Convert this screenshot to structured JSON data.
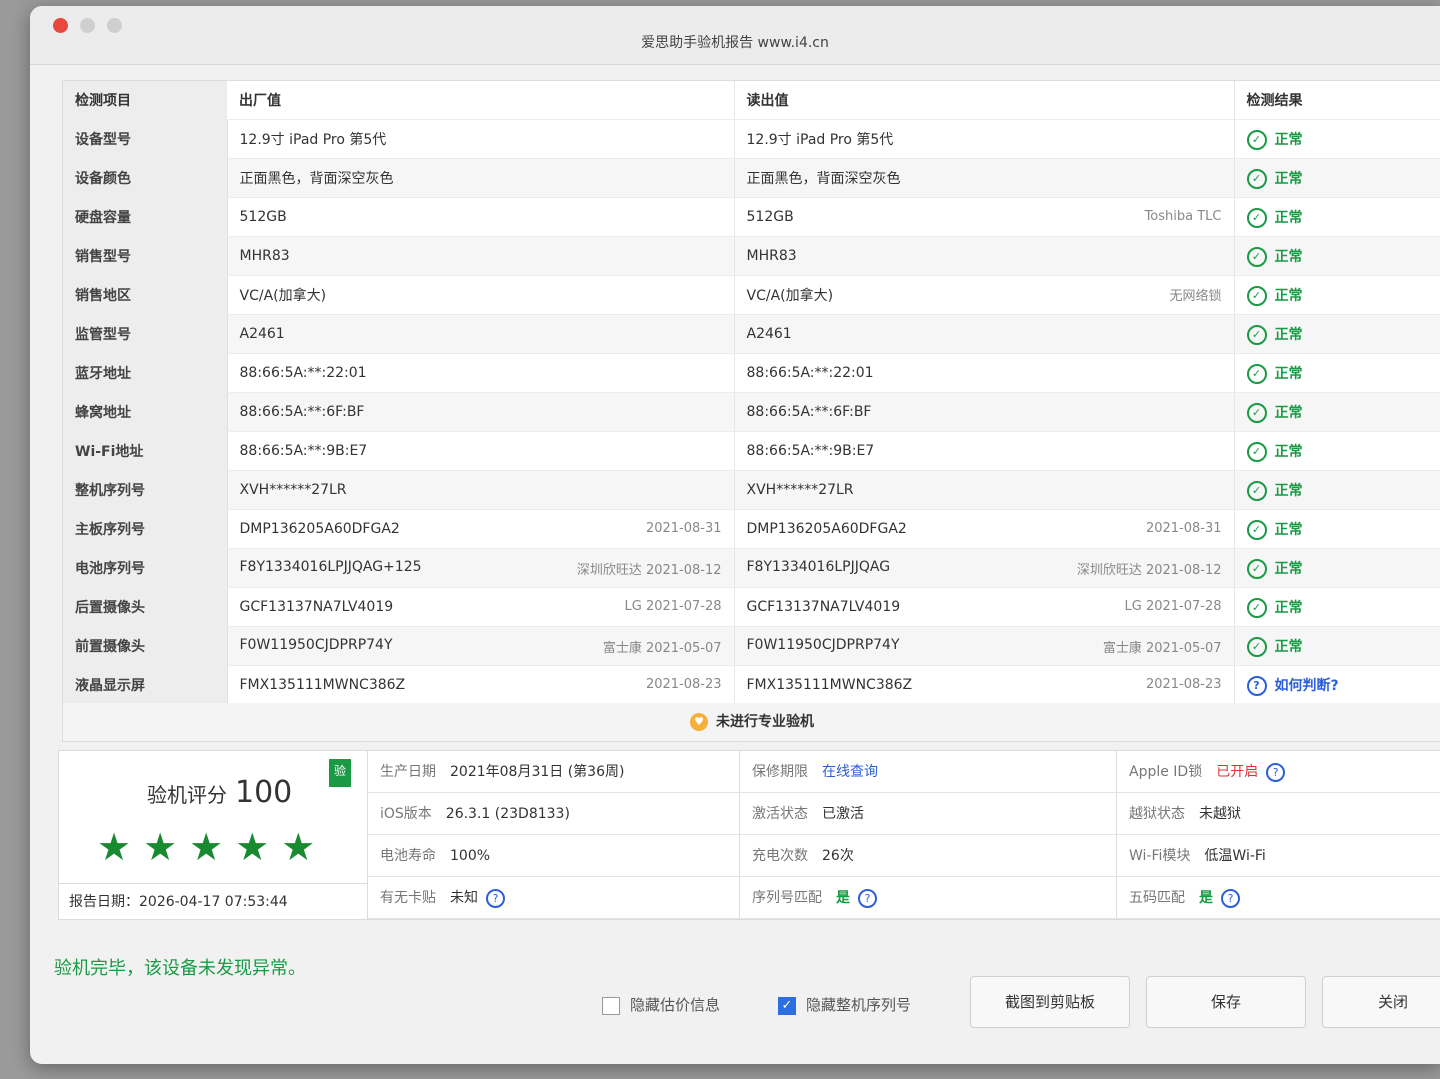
{
  "window": {
    "title": "爱思助手验机报告 www.i4.cn"
  },
  "table": {
    "headers": [
      "检测项目",
      "出厂值",
      "读出值",
      "检测结果"
    ],
    "rows": [
      {
        "item": "设备型号",
        "factory": "12.9寸 iPad Pro 第5代",
        "factory_note": "",
        "read": "12.9寸 iPad Pro 第5代",
        "read_note": "",
        "result": "正常"
      },
      {
        "item": "设备颜色",
        "factory": "正面黑色，背面深空灰色",
        "factory_note": "",
        "read": "正面黑色，背面深空灰色",
        "read_note": "",
        "result": "正常"
      },
      {
        "item": "硬盘容量",
        "factory": "512GB",
        "factory_note": "",
        "read": "512GB",
        "read_note": "Toshiba TLC",
        "result": "正常"
      },
      {
        "item": "销售型号",
        "factory": "MHR83",
        "factory_note": "",
        "read": "MHR83",
        "read_note": "",
        "result": "正常"
      },
      {
        "item": "销售地区",
        "factory": "VC/A(加拿大)",
        "factory_note": "",
        "read": "VC/A(加拿大)",
        "read_note": "无网络锁",
        "result": "正常"
      },
      {
        "item": "监管型号",
        "factory": "A2461",
        "factory_note": "",
        "read": "A2461",
        "read_note": "",
        "result": "正常"
      },
      {
        "item": "蓝牙地址",
        "factory": "88:66:5A:**:22:01",
        "factory_note": "",
        "read": "88:66:5A:**:22:01",
        "read_note": "",
        "result": "正常"
      },
      {
        "item": "蜂窝地址",
        "factory": "88:66:5A:**:6F:BF",
        "factory_note": "",
        "read": "88:66:5A:**:6F:BF",
        "read_note": "",
        "result": "正常"
      },
      {
        "item": "Wi-Fi地址",
        "factory": "88:66:5A:**:9B:E7",
        "factory_note": "",
        "read": "88:66:5A:**:9B:E7",
        "read_note": "",
        "result": "正常"
      },
      {
        "item": "整机序列号",
        "factory": "XVH******27LR",
        "factory_note": "",
        "read": "XVH******27LR",
        "read_note": "",
        "result": "正常"
      },
      {
        "item": "主板序列号",
        "factory": "DMP136205A60DFGA2",
        "factory_note": "2021-08-31",
        "read": "DMP136205A60DFGA2",
        "read_note": "2021-08-31",
        "result": "正常"
      },
      {
        "item": "电池序列号",
        "factory": "F8Y1334016LPJJQAG+125",
        "factory_note": "深圳欣旺达 2021-08-12",
        "read": "F8Y1334016LPJJQAG",
        "read_note": "深圳欣旺达 2021-08-12",
        "result": "正常"
      },
      {
        "item": "后置摄像头",
        "factory": "GCF13137NA7LV4019",
        "factory_note": "LG 2021-07-28",
        "read": "GCF13137NA7LV4019",
        "read_note": "LG 2021-07-28",
        "result": "正常"
      },
      {
        "item": "前置摄像头",
        "factory": "F0W11950CJDPRP74Y",
        "factory_note": "富士康 2021-05-07",
        "read": "F0W11950CJDPRP74Y",
        "read_note": "富士康 2021-05-07",
        "result": "正常"
      },
      {
        "item": "液晶显示屏",
        "factory": "FMX135111MWNC386Z",
        "factory_note": "2021-08-23",
        "read": "FMX135111MWNC386Z",
        "read_note": "2021-08-23",
        "result": "如何判断?"
      }
    ],
    "footer": "未进行专业验机"
  },
  "score": {
    "label": "验机评分",
    "value": "100",
    "tag": "验",
    "stars": "★★★★★",
    "report_date": "报告日期：2026-04-17 07:53:44"
  },
  "info": {
    "production_date_label": "生产日期",
    "production_date": "2021年08月31日 (第36周)",
    "warranty_label": "保修期限",
    "warranty": "在线查询",
    "appleid_label": "Apple ID锁",
    "appleid": "已开启",
    "ios_label": "iOS版本",
    "ios": "26.3.1 (23D8133)",
    "activation_label": "激活状态",
    "activation": "已激活",
    "jailbreak_label": "越狱状态",
    "jailbreak": "未越狱",
    "battery_label": "电池寿命",
    "battery": "100%",
    "charge_label": "充电次数",
    "charge": "26次",
    "wifi_label": "Wi-Fi模块",
    "wifi": "低温Wi-Fi",
    "sticker_label": "有无卡贴",
    "sticker": "未知",
    "serial_match_label": "序列号匹配",
    "serial_match": "是",
    "fivecode_label": "五码匹配",
    "fivecode": "是"
  },
  "summary": "验机完毕，该设备未发现异常。",
  "controls": {
    "hide_estimate": "隐藏估价信息",
    "hide_serial": "隐藏整机序列号",
    "copy_btn": "截图到剪贴板",
    "save_btn": "保存",
    "close_btn": "关闭"
  }
}
